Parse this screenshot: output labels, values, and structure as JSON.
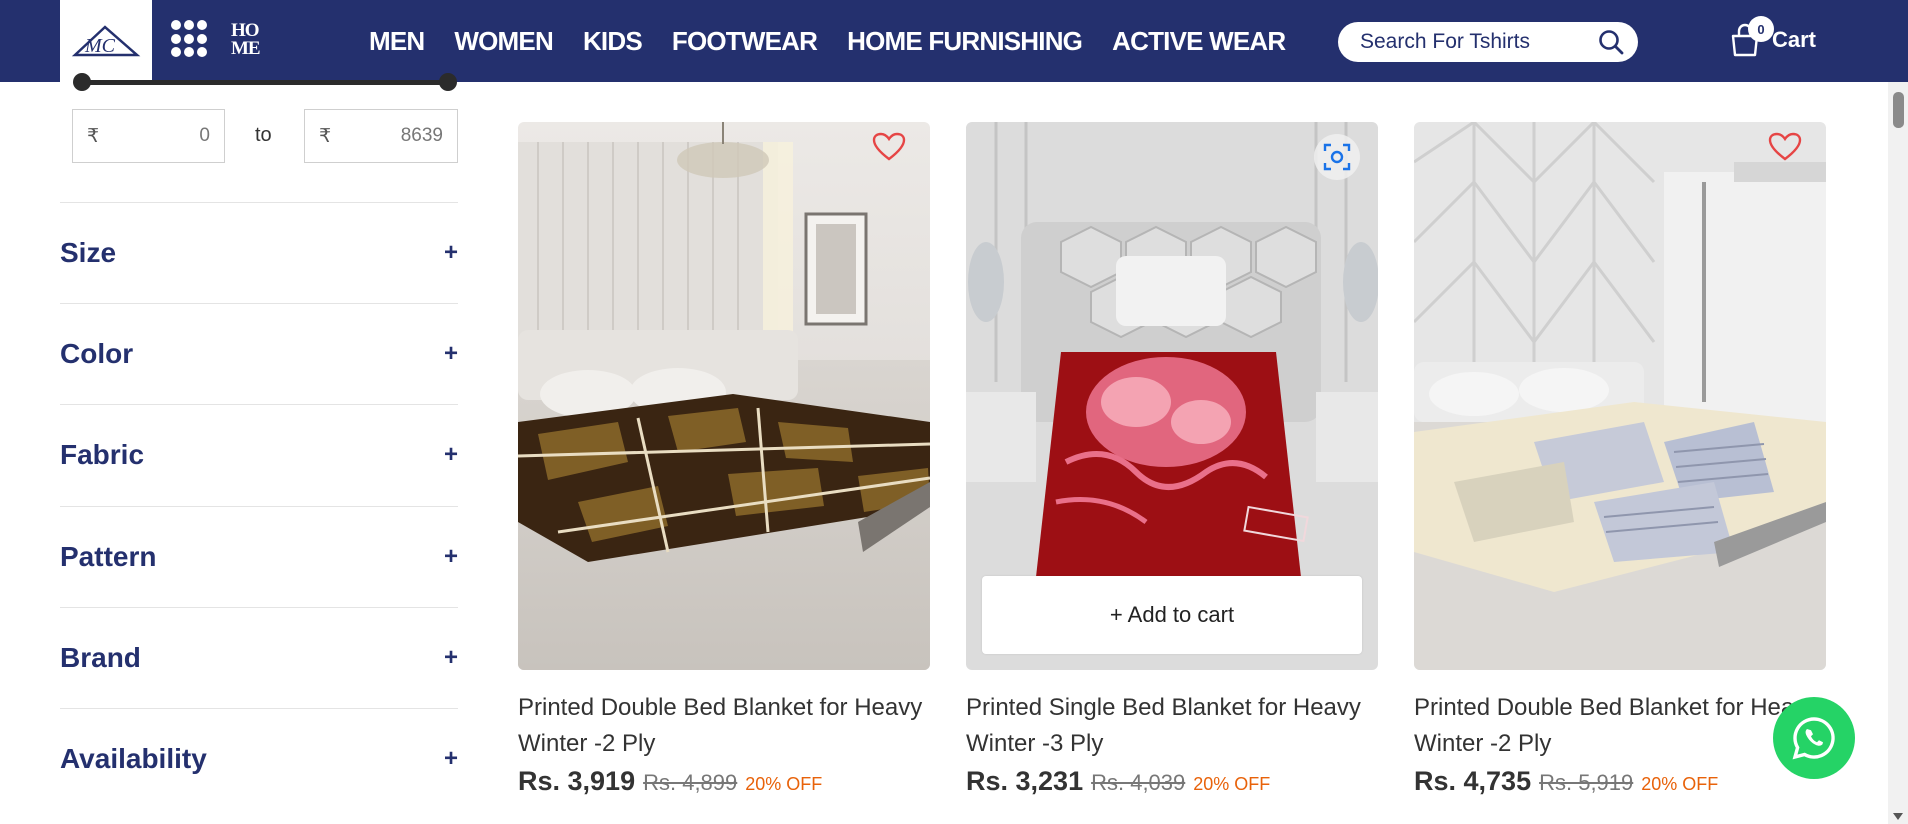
{
  "header": {
    "logo_text": "MC",
    "home_logo_line1": "HO",
    "home_logo_line2": "ME",
    "nav": [
      "MEN",
      "WOMEN",
      "KIDS",
      "FOOTWEAR",
      "HOME FURNISHING",
      "ACTIVE WEAR"
    ],
    "search_placeholder": "Search For Tshirts",
    "cart_count": "0",
    "cart_label": "Cart",
    "colors": {
      "brand": "#24306e"
    }
  },
  "filters": {
    "price": {
      "currency": "₹",
      "min": "0",
      "max": "8639",
      "to_label": "to"
    },
    "facets": [
      {
        "label": "Size",
        "toggle": "+"
      },
      {
        "label": "Color",
        "toggle": "+"
      },
      {
        "label": "Fabric",
        "toggle": "+"
      },
      {
        "label": "Pattern",
        "toggle": "+"
      },
      {
        "label": "Brand",
        "toggle": "+"
      },
      {
        "label": "Availability",
        "toggle": "+"
      }
    ]
  },
  "products": [
    {
      "title": "Printed Double Bed Blanket for Heavy Winter -2 Ply",
      "price": "Rs. 3,919",
      "mrp": "Rs. 4,899",
      "discount": "20% OFF"
    },
    {
      "title": "Printed Single Bed Blanket for Heavy Winter -3 Ply",
      "price": "Rs. 3,231",
      "mrp": "Rs. 4,039",
      "discount": "20% OFF",
      "add_to_cart": "+ Add to cart"
    },
    {
      "title": "Printed Double Bed Blanket for Heavy Winter -2 Ply",
      "price": "Rs. 4,735",
      "mrp": "Rs. 5,919",
      "discount": "20% OFF"
    }
  ],
  "icons": [
    "grid-menu-icon",
    "search-icon",
    "cart-bag-icon",
    "heart-icon",
    "lens-icon",
    "whatsapp-icon"
  ]
}
